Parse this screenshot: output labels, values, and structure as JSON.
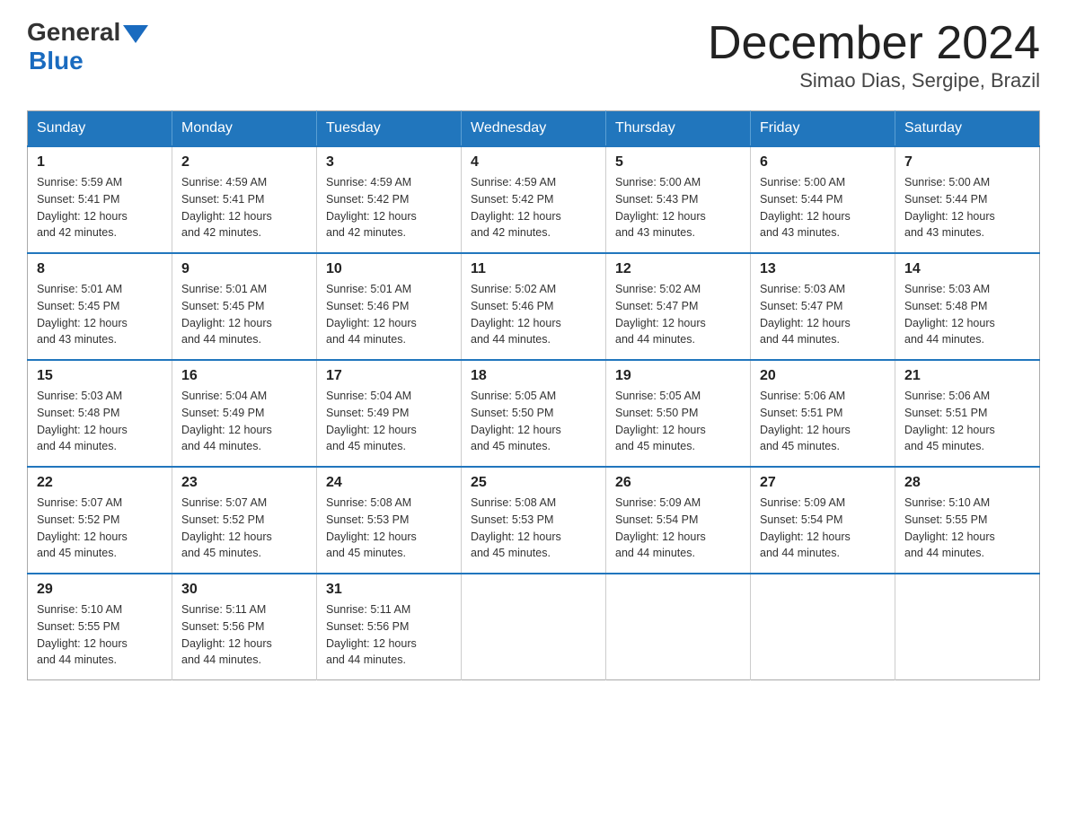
{
  "header": {
    "logo_general": "General",
    "logo_blue": "Blue",
    "month_title": "December 2024",
    "location": "Simao Dias, Sergipe, Brazil"
  },
  "days_of_week": [
    "Sunday",
    "Monday",
    "Tuesday",
    "Wednesday",
    "Thursday",
    "Friday",
    "Saturday"
  ],
  "weeks": [
    [
      {
        "day": "1",
        "sunrise": "5:59 AM",
        "sunset": "5:41 PM",
        "daylight": "12 hours and 42 minutes."
      },
      {
        "day": "2",
        "sunrise": "4:59 AM",
        "sunset": "5:41 PM",
        "daylight": "12 hours and 42 minutes."
      },
      {
        "day": "3",
        "sunrise": "4:59 AM",
        "sunset": "5:42 PM",
        "daylight": "12 hours and 42 minutes."
      },
      {
        "day": "4",
        "sunrise": "4:59 AM",
        "sunset": "5:42 PM",
        "daylight": "12 hours and 42 minutes."
      },
      {
        "day": "5",
        "sunrise": "5:00 AM",
        "sunset": "5:43 PM",
        "daylight": "12 hours and 43 minutes."
      },
      {
        "day": "6",
        "sunrise": "5:00 AM",
        "sunset": "5:44 PM",
        "daylight": "12 hours and 43 minutes."
      },
      {
        "day": "7",
        "sunrise": "5:00 AM",
        "sunset": "5:44 PM",
        "daylight": "12 hours and 43 minutes."
      }
    ],
    [
      {
        "day": "8",
        "sunrise": "5:01 AM",
        "sunset": "5:45 PM",
        "daylight": "12 hours and 43 minutes."
      },
      {
        "day": "9",
        "sunrise": "5:01 AM",
        "sunset": "5:45 PM",
        "daylight": "12 hours and 44 minutes."
      },
      {
        "day": "10",
        "sunrise": "5:01 AM",
        "sunset": "5:46 PM",
        "daylight": "12 hours and 44 minutes."
      },
      {
        "day": "11",
        "sunrise": "5:02 AM",
        "sunset": "5:46 PM",
        "daylight": "12 hours and 44 minutes."
      },
      {
        "day": "12",
        "sunrise": "5:02 AM",
        "sunset": "5:47 PM",
        "daylight": "12 hours and 44 minutes."
      },
      {
        "day": "13",
        "sunrise": "5:03 AM",
        "sunset": "5:47 PM",
        "daylight": "12 hours and 44 minutes."
      },
      {
        "day": "14",
        "sunrise": "5:03 AM",
        "sunset": "5:48 PM",
        "daylight": "12 hours and 44 minutes."
      }
    ],
    [
      {
        "day": "15",
        "sunrise": "5:03 AM",
        "sunset": "5:48 PM",
        "daylight": "12 hours and 44 minutes."
      },
      {
        "day": "16",
        "sunrise": "5:04 AM",
        "sunset": "5:49 PM",
        "daylight": "12 hours and 44 minutes."
      },
      {
        "day": "17",
        "sunrise": "5:04 AM",
        "sunset": "5:49 PM",
        "daylight": "12 hours and 45 minutes."
      },
      {
        "day": "18",
        "sunrise": "5:05 AM",
        "sunset": "5:50 PM",
        "daylight": "12 hours and 45 minutes."
      },
      {
        "day": "19",
        "sunrise": "5:05 AM",
        "sunset": "5:50 PM",
        "daylight": "12 hours and 45 minutes."
      },
      {
        "day": "20",
        "sunrise": "5:06 AM",
        "sunset": "5:51 PM",
        "daylight": "12 hours and 45 minutes."
      },
      {
        "day": "21",
        "sunrise": "5:06 AM",
        "sunset": "5:51 PM",
        "daylight": "12 hours and 45 minutes."
      }
    ],
    [
      {
        "day": "22",
        "sunrise": "5:07 AM",
        "sunset": "5:52 PM",
        "daylight": "12 hours and 45 minutes."
      },
      {
        "day": "23",
        "sunrise": "5:07 AM",
        "sunset": "5:52 PM",
        "daylight": "12 hours and 45 minutes."
      },
      {
        "day": "24",
        "sunrise": "5:08 AM",
        "sunset": "5:53 PM",
        "daylight": "12 hours and 45 minutes."
      },
      {
        "day": "25",
        "sunrise": "5:08 AM",
        "sunset": "5:53 PM",
        "daylight": "12 hours and 45 minutes."
      },
      {
        "day": "26",
        "sunrise": "5:09 AM",
        "sunset": "5:54 PM",
        "daylight": "12 hours and 44 minutes."
      },
      {
        "day": "27",
        "sunrise": "5:09 AM",
        "sunset": "5:54 PM",
        "daylight": "12 hours and 44 minutes."
      },
      {
        "day": "28",
        "sunrise": "5:10 AM",
        "sunset": "5:55 PM",
        "daylight": "12 hours and 44 minutes."
      }
    ],
    [
      {
        "day": "29",
        "sunrise": "5:10 AM",
        "sunset": "5:55 PM",
        "daylight": "12 hours and 44 minutes."
      },
      {
        "day": "30",
        "sunrise": "5:11 AM",
        "sunset": "5:56 PM",
        "daylight": "12 hours and 44 minutes."
      },
      {
        "day": "31",
        "sunrise": "5:11 AM",
        "sunset": "5:56 PM",
        "daylight": "12 hours and 44 minutes."
      },
      null,
      null,
      null,
      null
    ]
  ],
  "labels": {
    "sunrise": "Sunrise:",
    "sunset": "Sunset:",
    "daylight": "Daylight:"
  }
}
